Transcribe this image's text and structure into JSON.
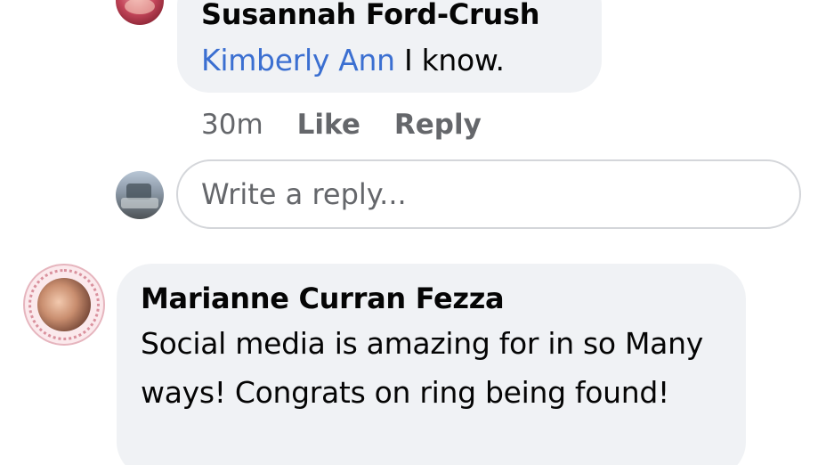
{
  "comments": [
    {
      "author": "Susannah Ford-Crush",
      "mention": "Kimberly Ann",
      "text": " I know.",
      "time": "30m",
      "actions": {
        "like": "Like",
        "reply": "Reply"
      }
    },
    {
      "author": "Marianne Curran Fezza",
      "text": "Social media is amazing for in so Many ways! Congrats on ring being found!"
    }
  ],
  "reply_box": {
    "placeholder": "Write a reply..."
  },
  "colors": {
    "bubble_background": "#f0f2f5",
    "mention": "#3b6fd1",
    "meta_text": "#65676b",
    "primary_text": "#050505",
    "input_border": "#d4d6da"
  },
  "icons": {
    "susannah_avatar": "profile-photo-avatar",
    "current_user_avatar": "profile-photo-avatar",
    "marianne_avatar": "profile-photo-avatar"
  }
}
